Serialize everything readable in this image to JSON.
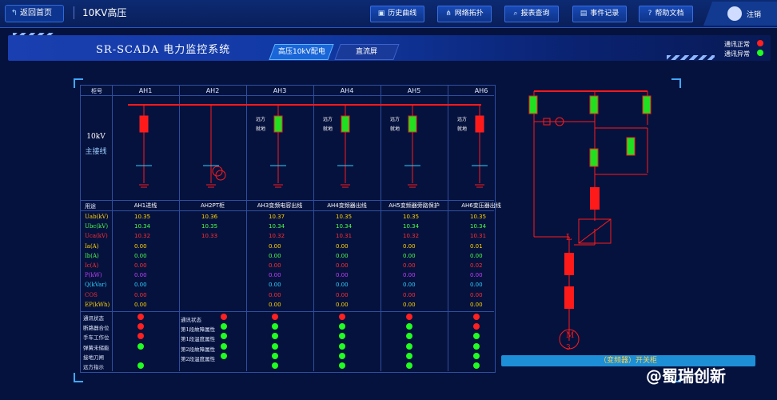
{
  "topbar": {
    "back_label": "返回首页",
    "page_title": "10KV高压",
    "nav": [
      {
        "label": "历史曲线",
        "icon": "chart-icon"
      },
      {
        "label": "网络拓扑",
        "icon": "topology-icon"
      },
      {
        "label": "报表查询",
        "icon": "search-icon"
      },
      {
        "label": "事件记录",
        "icon": "document-icon"
      },
      {
        "label": "帮助文档",
        "icon": "help-icon"
      }
    ],
    "user_label": "注销"
  },
  "banner": {
    "system_name": "SR-SCADA 电力监控系统",
    "tabs": [
      {
        "label": "高压10kV配电",
        "active": true
      },
      {
        "label": "直流屏",
        "active": false
      }
    ],
    "legend": [
      {
        "label": "通讯正常",
        "color": "#ff2020"
      },
      {
        "label": "通讯异常",
        "color": "#20ff20"
      }
    ]
  },
  "table": {
    "cabinet_header": "柜号",
    "columns": [
      "AH1",
      "AH2",
      "AH3",
      "AH4",
      "AH5",
      "AH6"
    ],
    "main_bus_title": [
      "10kV",
      "主接线"
    ],
    "switch_labels": [
      "远方",
      "就地"
    ],
    "purpose_header": "用途",
    "purposes": [
      "AH1进线",
      "AH2PT柜",
      "AH3变频电容出线",
      "AH4变频器出线",
      "AH5变频器旁路保护",
      "AH6变压器出线"
    ],
    "measure_labels": [
      "Uab(kV)",
      "Ubc(kV)",
      "Uca(kV)",
      "Ia(A)",
      "Ib(A)",
      "Ic(A)",
      "P(kW)",
      "Q(kVar)",
      "COS",
      "EP(kWh)"
    ],
    "measure_colors": [
      "#ffd400",
      "#4cff4c",
      "#ff3030",
      "#ffd400",
      "#4cff4c",
      "#ff3030",
      "#c040ff",
      "#30d0ff",
      "#ff3030",
      "#ffd400"
    ],
    "values": [
      [
        "10.35",
        "10.34",
        "10.32",
        "0.00",
        "0.00",
        "0.00",
        "0.00",
        "0.00",
        "0.00",
        "0.00"
      ],
      [
        "10.36",
        "10.35",
        "10.33",
        "",
        "",
        "",
        "",
        "",
        "",
        ""
      ],
      [
        "10.37",
        "10.34",
        "10.32",
        "0.00",
        "0.00",
        "0.00",
        "0.00",
        "0.00",
        "0.00",
        "0.00"
      ],
      [
        "10.35",
        "10.34",
        "10.31",
        "0.00",
        "0.00",
        "0.00",
        "0.00",
        "0.00",
        "0.00",
        "0.00"
      ],
      [
        "10.35",
        "10.34",
        "10.32",
        "0.00",
        "0.00",
        "0.00",
        "0.00",
        "0.00",
        "0.00",
        "0.00"
      ],
      [
        "10.35",
        "10.34",
        "10.31",
        "0.01",
        "0.00",
        "0.02",
        "0.00",
        "0.00",
        "0.00",
        "0.00"
      ]
    ],
    "status_labels": [
      "通讯状态",
      "断路器合位",
      "手车工作位",
      "弹簧未储能",
      "接地刀闸",
      "远方指示"
    ],
    "pt_status_labels": [
      "通讯状态",
      "第1段故障属性",
      "第1段温度属性",
      "第2段故障属性",
      "第2段温度属性"
    ],
    "status": [
      [
        "#ff2020",
        "#ff2020",
        "#ff2020",
        "#20ff20",
        "",
        "#20ff20"
      ],
      [
        "#ff2020",
        "#20ff20",
        "#20ff20",
        "#20ff20",
        "#20ff20"
      ],
      [
        "#ff2020",
        "#20ff20",
        "#20ff20",
        "#20ff20",
        "#20ff20",
        "#20ff20"
      ],
      [
        "#ff2020",
        "#20ff20",
        "#20ff20",
        "#20ff20",
        "#20ff20",
        "#20ff20"
      ],
      [
        "#ff2020",
        "#20ff20",
        "#20ff20",
        "#20ff20",
        "#20ff20",
        "#20ff20"
      ],
      [
        "#ff2020",
        "#ff2020",
        "#20ff20",
        "#20ff20",
        "#20ff20",
        "#20ff20"
      ]
    ]
  },
  "right_diagram": {
    "reactor_label": "L",
    "motor_label": [
      "M",
      "3"
    ],
    "footer_label": "（变频器）开关柜"
  },
  "watermark": "@蜀瑞创新"
}
